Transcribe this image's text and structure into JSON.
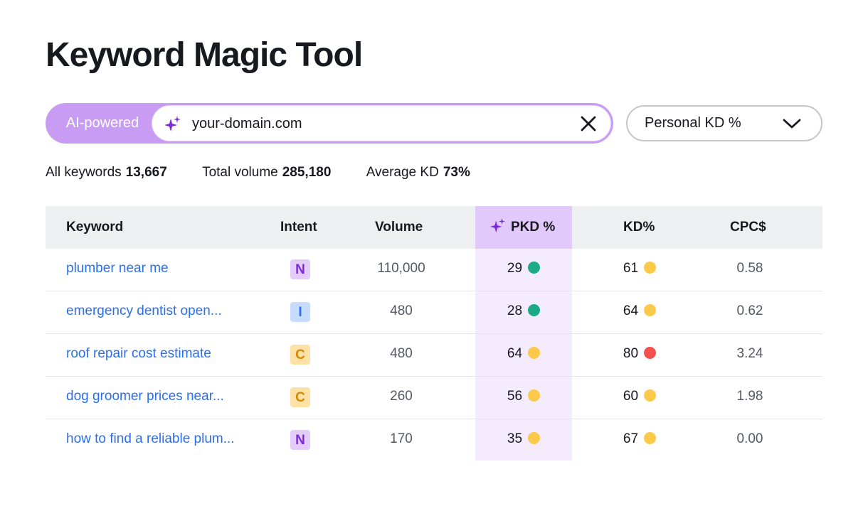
{
  "page": {
    "title": "Keyword Magic Tool"
  },
  "search": {
    "mode_label": "AI-powered",
    "value": "your-domain.com",
    "accent_color": "#c89cf2"
  },
  "kd_select": {
    "selected": "Personal KD %"
  },
  "stats": [
    {
      "label": "All keywords",
      "value": "13,667"
    },
    {
      "label": "Total volume",
      "value": "285,180"
    },
    {
      "label": "Average KD",
      "value": "73%"
    }
  ],
  "table": {
    "columns": {
      "keyword": "Keyword",
      "intent": "Intent",
      "volume": "Volume",
      "pkd": "PKD %",
      "kd": "KD%",
      "cpc": "CPC$"
    },
    "rows": [
      {
        "keyword": "plumber near me",
        "intent": "N",
        "volume": "110,000",
        "pkd": "29",
        "pkd_color": "#1aaa84",
        "kd": "61",
        "kd_color": "#fdc94b",
        "cpc": "0.58"
      },
      {
        "keyword": "emergency dentist open...",
        "intent": "I",
        "volume": "480",
        "pkd": "28",
        "pkd_color": "#1aaa84",
        "kd": "64",
        "kd_color": "#fdc94b",
        "cpc": "0.62"
      },
      {
        "keyword": "roof repair cost estimate",
        "intent": "C",
        "volume": "480",
        "pkd": "64",
        "pkd_color": "#fdc94b",
        "kd": "80",
        "kd_color": "#f2514d",
        "cpc": "3.24"
      },
      {
        "keyword": "dog groomer prices near...",
        "intent": "C",
        "volume": "260",
        "pkd": "56",
        "pkd_color": "#fdc94b",
        "kd": "60",
        "kd_color": "#fdc94b",
        "cpc": "1.98"
      },
      {
        "keyword": "how to find a reliable plum...",
        "intent": "N",
        "volume": "170",
        "pkd": "35",
        "pkd_color": "#fdc94b",
        "kd": "67",
        "kd_color": "#fdc94b",
        "cpc": "0.00"
      }
    ]
  }
}
